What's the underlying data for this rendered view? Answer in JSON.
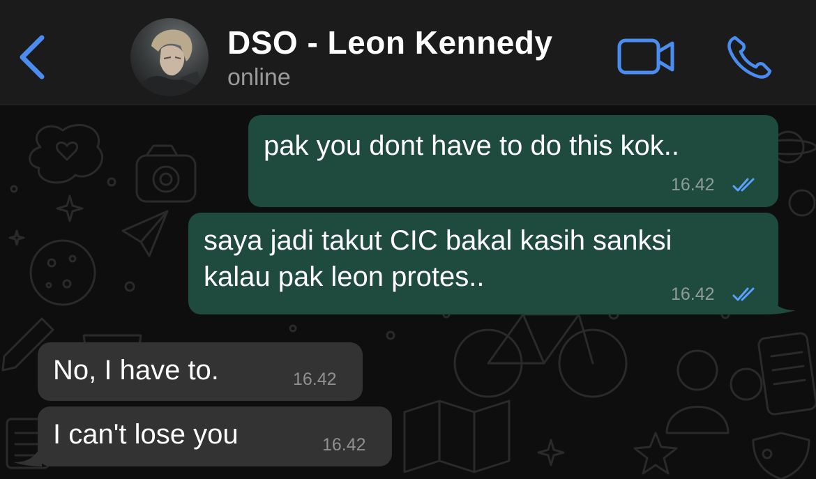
{
  "header": {
    "back_icon": "chevron-left-icon",
    "contact_name": "DSO - Leon Kennedy",
    "status": "online",
    "video_icon": "video-camera-icon",
    "call_icon": "phone-icon",
    "accent_color": "#4a8cf0"
  },
  "messages": [
    {
      "direction": "outgoing",
      "text": "pak you dont have to do this kok..",
      "time": "16.42",
      "read_status_icon": "double-check-icon"
    },
    {
      "direction": "outgoing",
      "text": "saya jadi takut CIC bakal kasih sanksi\nkalau pak leon protes..",
      "time": "16.42",
      "read_status_icon": "double-check-icon"
    },
    {
      "direction": "incoming",
      "text": "No, I have to.",
      "time": "16.42"
    },
    {
      "direction": "incoming",
      "text": "I can't lose you",
      "time": "16.42"
    }
  ],
  "colors": {
    "outgoing_bubble": "#1f4a3e",
    "incoming_bubble": "#333333",
    "read_ticks": "#5aa0ff"
  }
}
